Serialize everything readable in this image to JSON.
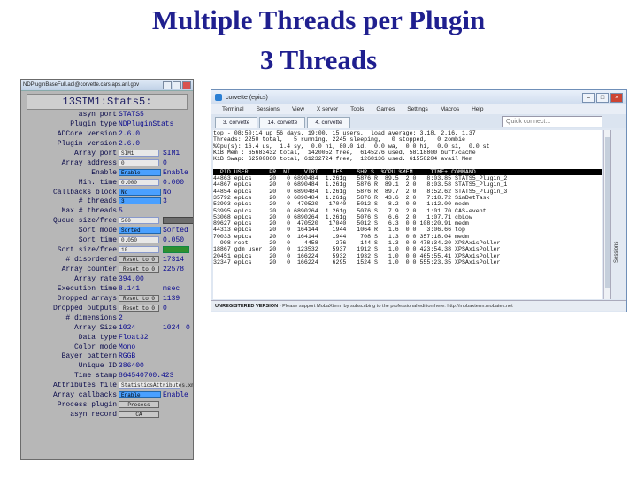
{
  "slide": {
    "title_line1": "Multiple Threads per Plugin",
    "title_line2": "3 Threads"
  },
  "medm": {
    "window_title": "NDPluginBaseFull.adl@corvette.cars.aps.anl.gov",
    "panel_title": "13SIM1:Stats5:",
    "rows": [
      {
        "label": "asyn port",
        "value": "STATS5"
      },
      {
        "label": "Plugin type",
        "value": "NDPluginStats"
      },
      {
        "label": "ADCore version",
        "value": "2.6.0"
      },
      {
        "label": "Plugin version",
        "value": "2.6.0"
      },
      {
        "label": "Array port",
        "input": "SIM1",
        "value": "SIM1"
      },
      {
        "label": "Array address",
        "input": "0",
        "value": "0"
      },
      {
        "label": "Enable",
        "menu": "Enable",
        "value": "Enable"
      },
      {
        "label": "Min. time",
        "input": "0.000",
        "value": "0.000"
      },
      {
        "label": "Callbacks block",
        "menu": "No",
        "value": "No"
      },
      {
        "label": "# threads",
        "menu": "3",
        "value": "3"
      },
      {
        "label": "Max # threads",
        "value": "5"
      },
      {
        "label": "Queue size/free",
        "input": "500",
        "value": ""
      },
      {
        "label": "Sort mode",
        "menu": "Sorted",
        "value": "Sorted"
      },
      {
        "label": "Sort time",
        "input": "0.050",
        "value": "0.050"
      },
      {
        "label": "Sort size/free",
        "input": "10",
        "value": "10"
      },
      {
        "label": "# disordered",
        "button": "Reset to 0",
        "value": "17314"
      },
      {
        "label": "Array counter",
        "button": "Reset to 0",
        "value": "22578"
      },
      {
        "label": "Array rate",
        "value": "394.00"
      },
      {
        "label": "Execution time",
        "value": "8.141",
        "unit": "msec"
      },
      {
        "label": "Dropped arrays",
        "button": "Reset to 0",
        "value": "1139"
      },
      {
        "label": "Dropped outputs",
        "button": "Reset to 0",
        "value": "0"
      },
      {
        "label": "# dimensions",
        "value": "2"
      },
      {
        "label": "Array Size",
        "value": "1024",
        "value2": "1024",
        "value3": "0"
      },
      {
        "label": "Data type",
        "value": "Float32"
      },
      {
        "label": "Color mode",
        "value": "Mono"
      },
      {
        "label": "Bayer pattern",
        "value": "RGGB"
      },
      {
        "label": "Unique ID",
        "value": "386400"
      },
      {
        "label": "Time stamp",
        "value": "864540700.423"
      },
      {
        "label": "Attributes file",
        "wide": "StatisticsAttributes.xml"
      },
      {
        "label": "Array callbacks",
        "menu": "Enable",
        "value": "Enable"
      },
      {
        "label": "Process plugin",
        "button": "Process"
      },
      {
        "label": "asyn record",
        "button": "CA"
      }
    ]
  },
  "terminal": {
    "window_title": "corvette (epics)",
    "menu": [
      "Terminal",
      "Sessions",
      "View",
      "X server",
      "Tools",
      "Games",
      "Settings",
      "Macros",
      "Help"
    ],
    "tabs": [
      "3. corvette",
      "14. corvette",
      "4. corvette"
    ],
    "quick_connect": "Quick connect...",
    "side_label": "Sessions",
    "lines": [
      "top - 08:50:14 up 56 days, 19:00, 15 users,  load average: 3.18, 2.16, 1.37",
      "Threads: 2250 total,   5 running, 2245 sleeping,   0 stopped,   0 zombie",
      "%Cpu(s): 16.4 us,  1.4 sy,  0.0 ni, 80.0 id,  0.0 wa,  0.0 hi,  0.0 si,  0.0 st",
      "KiB Mem : 65683432 total,  1420052 free,  6145276 used, 58118800 buff/cache",
      "KiB Swap: 62500860 total, 61232724 free,  1268136 used. 61558204 avail Mem",
      "",
      "  PID USER      PR  NI    VIRT    RES    SHR S  %CPU %MEM     TIME+ COMMAND",
      "44863 epics     20   0 6890484  1.261g   5876 R  89.5  2.0   8:03.85 STATS5_Plugin_2",
      "44867 epics     20   0 6890484  1.261g   5876 R  89.1  2.0   8:03.58 STATS5_Plugin_1",
      "44854 epics     20   0 6890484  1.261g   5876 R  89.7  2.0   8:52.62 STATS5_Plugin_3",
      "35792 epics     20   0 6890484  1.261g   5876 R  43.6  2.0   7:18.72 SimDetTask",
      "53993 epics     20   0  470520   17040   5012 S   8.2  0.0   1:12.00 medm",
      "53995 epics     20   0 6890264  1.261g   5076 S   7.9  2.0   1:01.70 CAS-event",
      "53068 epics     20   0 6890264  1.261g   5076 S   6.6  2.0   1:07.71 cbLow",
      "89627 epics     20   0  470520   17040   5012 S   6.3  0.0 108:20.91 medm",
      "44313 epics     20   0  164144    1944   1064 R   1.6  0.0   3:06.66 top",
      "70033 epics     20   0  164144    1944    708 S   1.3  0.0 357:18.04 medm",
      "  998 root      20   0    4458     276    144 S   1.3  0.0 478:34.20 XPSAxisPoller",
      "18867 gdm_user  20   0  123532    5937   1912 S   1.0  0.0 423:54.38 XPSAxisPoller",
      "20451 epics     20   0  166224    5932   1932 S   1.0  0.0 465:55.41 XPSAxisPoller",
      "32347 epics     20   0  166224    6295   1524 S   1.0  0.0 555:23.35 XPSAxisPoller"
    ],
    "status_bold": "UNREGISTERED VERSION",
    "status_text": " - Please support MobaXterm by subscribing to the professional edition here: http://mobaxterm.mobatek.net"
  }
}
